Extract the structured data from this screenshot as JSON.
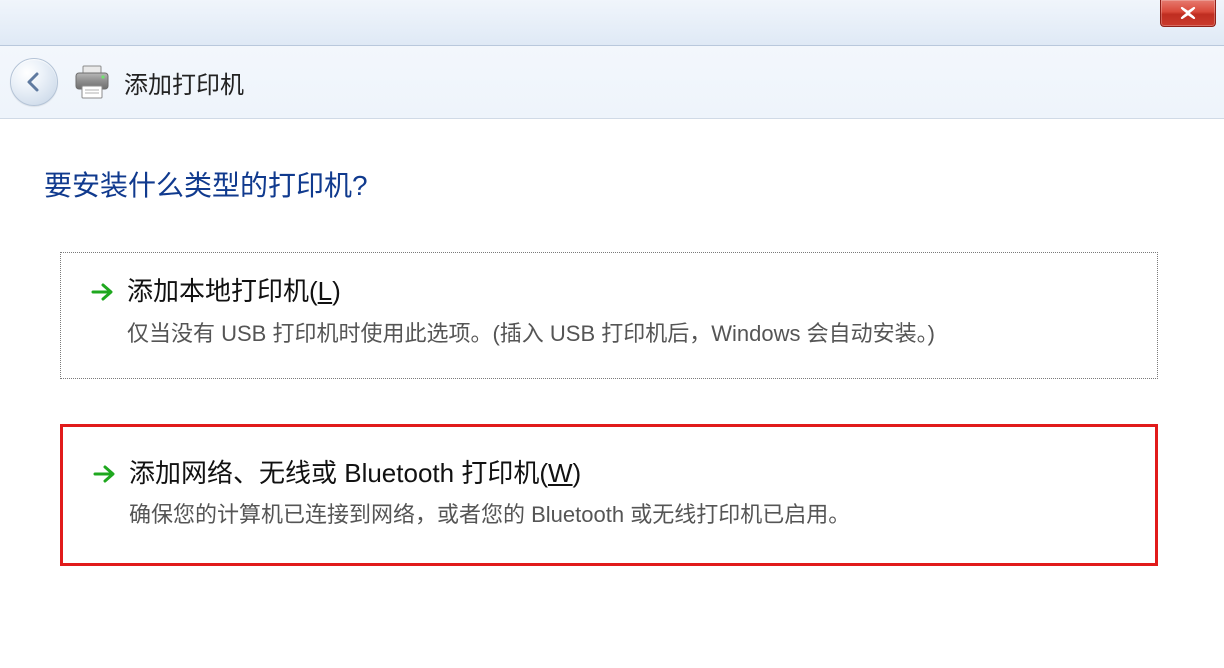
{
  "header": {
    "title": "添加打印机"
  },
  "page": {
    "heading": "要安装什么类型的打印机?"
  },
  "options": [
    {
      "title_pre": "添加本地打印机(",
      "title_key": "L",
      "title_post": ")",
      "desc": "仅当没有 USB 打印机时使用此选项。(插入 USB 打印机后，Windows 会自动安装。)"
    },
    {
      "title_pre": "添加网络、无线或 Bluetooth 打印机(",
      "title_key": "W",
      "title_post": ")",
      "desc": "确保您的计算机已连接到网络，或者您的 Bluetooth 或无线打印机已启用。"
    }
  ]
}
